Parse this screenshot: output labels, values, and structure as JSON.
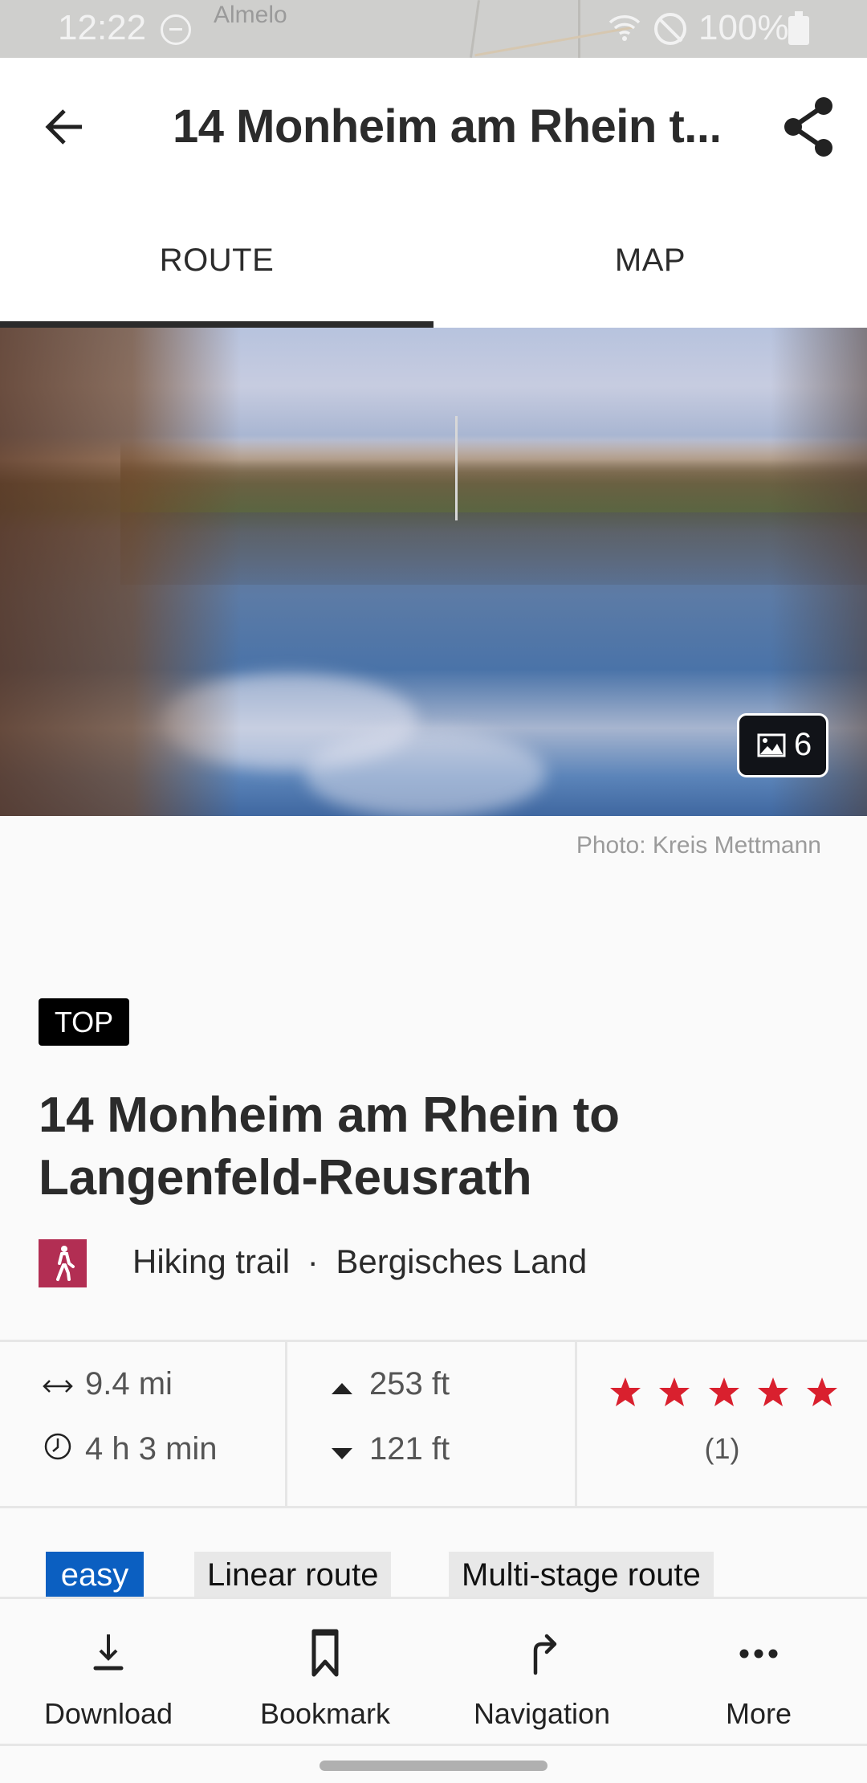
{
  "status_bar": {
    "time": "12:22",
    "map_place_label": "Almelo",
    "battery": "100%",
    "icons": [
      "do-not-disturb-icon",
      "wifi-icon",
      "blocked-icon",
      "battery-icon"
    ]
  },
  "app_bar": {
    "title": "14 Monheim am Rhein t...",
    "back_icon": "arrow-left-icon",
    "share_icon": "share-icon"
  },
  "tabs": [
    {
      "label": "ROUTE",
      "selected": true
    },
    {
      "label": "MAP",
      "selected": false
    }
  ],
  "hero": {
    "photo_count": "6",
    "photo_count_icon": "image-icon",
    "credit": "Photo: Kreis Mettmann"
  },
  "route": {
    "badge": "TOP",
    "title": "14 Monheim am Rhein to Langenfeld-Reusrath",
    "category": "Hiking trail",
    "separator": "·",
    "region": "Bergisches Land",
    "category_color": "#b22e53"
  },
  "stats": {
    "distance": "9.4 mi",
    "duration": "4 h 3 min",
    "ascent": "253 ft",
    "descent": "121 ft",
    "rating": 5,
    "rating_max": 5,
    "rating_count": "(1)",
    "star_color": "#d9202e"
  },
  "tags": [
    {
      "label": "easy",
      "color": "#0b5fc1"
    },
    {
      "label": "Linear route"
    },
    {
      "label": "Multi-stage route"
    }
  ],
  "actions": [
    {
      "label": "Download",
      "icon": "download-icon"
    },
    {
      "label": "Bookmark",
      "icon": "bookmark-icon"
    },
    {
      "label": "Navigation",
      "icon": "turn-right-icon"
    },
    {
      "label": "More",
      "icon": "more-horizontal-icon"
    }
  ]
}
